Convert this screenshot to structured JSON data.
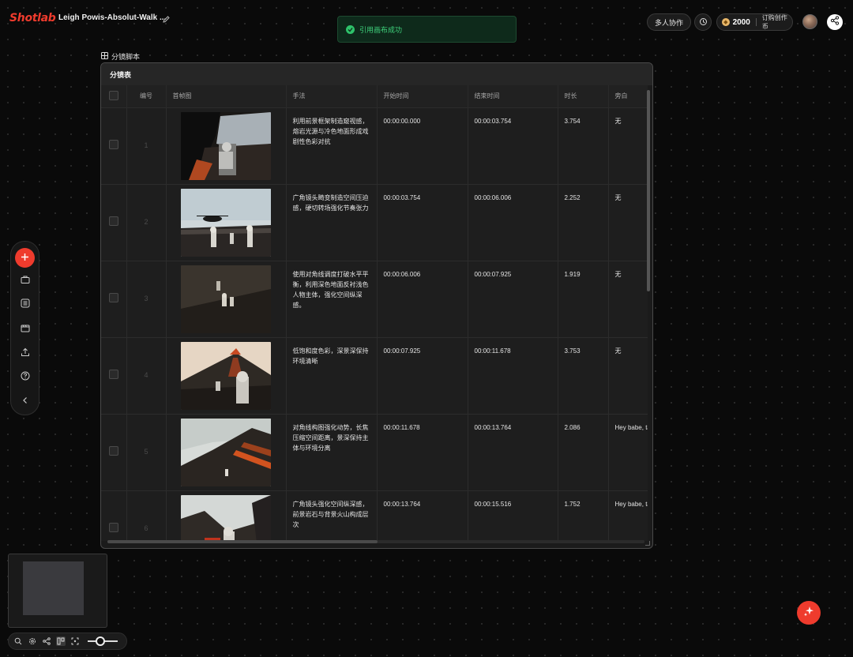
{
  "app": {
    "logo": "Shotlab",
    "project_title": "Leigh Powis-Absolut-Walk ..."
  },
  "toast": {
    "message": "引用画布成功"
  },
  "header_right": {
    "collab_label": "多人协作",
    "credits": "2000",
    "subscribe_label": "订购创作币"
  },
  "panel": {
    "label": "分镜脚本",
    "title": "分镜表"
  },
  "table": {
    "columns": [
      "编号",
      "首帧图",
      "手法",
      "开始时间",
      "结束时间",
      "时长",
      "旁白"
    ],
    "rows": [
      {
        "num": "1",
        "technique": "利用前景框架制造窥视感，熔岩光源与冷色地面形成戏剧性色彩对抗",
        "start": "00:00:00.000",
        "end": "00:00:03.754",
        "duration": "3.754",
        "narration": "无"
      },
      {
        "num": "2",
        "technique": "广角镜头畸变制造空间压迫感，硬切转场强化节奏张力",
        "start": "00:00:03.754",
        "end": "00:00:06.006",
        "duration": "2.252",
        "narration": "无"
      },
      {
        "num": "3",
        "technique": "使用对角线调度打破水平平衡，利用深色地面反衬浅色人物主体，强化空间纵深感。",
        "start": "00:00:06.006",
        "end": "00:00:07.925",
        "duration": "1.919",
        "narration": "无"
      },
      {
        "num": "4",
        "technique": "低饱和度色彩，深景深保持环境清晰",
        "start": "00:00:07.925",
        "end": "00:00:11.678",
        "duration": "3.753",
        "narration": "无"
      },
      {
        "num": "5",
        "technique": "对角线构图强化动势，长焦压缩空间距离，景深保持主体与环境分离",
        "start": "00:00:11.678",
        "end": "00:00:13.764",
        "duration": "2.086",
        "narration": "Hey babe, take a walk on the wild side"
      },
      {
        "num": "6",
        "technique": "广角镜头强化空间纵深感，前景岩石与背景火山构成层次",
        "start": "00:00:13.764",
        "end": "00:00:15.516",
        "duration": "1.752",
        "narration": "Hey babe, take a walk on the wild side"
      }
    ]
  },
  "colors": {
    "accent": "#ef3b2d",
    "success": "#3fd27c",
    "background": "#0a0a0a",
    "panel": "#1b1b1b"
  },
  "icons": {
    "edit": "pencil-icon",
    "toast": "check-circle-icon",
    "history": "history-icon",
    "coin": "coin-icon",
    "share": "share-icon",
    "add": "plus-icon",
    "ai": "sparkle-icon"
  }
}
